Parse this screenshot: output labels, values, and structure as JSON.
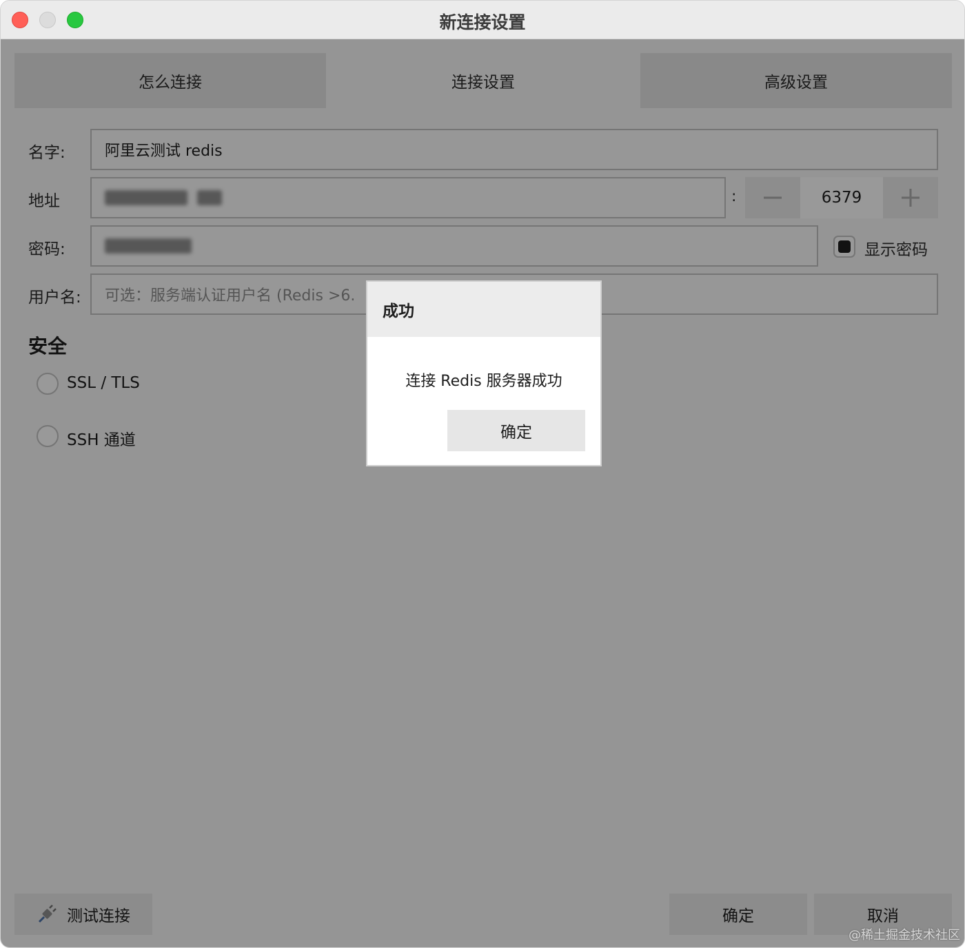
{
  "window": {
    "title": "新连接设置"
  },
  "tabs": [
    {
      "label": "怎么连接"
    },
    {
      "label": "连接设置"
    },
    {
      "label": "高级设置"
    }
  ],
  "form": {
    "name": {
      "label": "名字:",
      "value": "阿里云测试 redis"
    },
    "address": {
      "label": "地址",
      "value_hidden": true
    },
    "port": {
      "separator": ":",
      "value": "6379",
      "decrement_icon": "minus-icon",
      "increment_icon": "plus-icon"
    },
    "password": {
      "label": "密码:",
      "value_hidden": true
    },
    "show_password": {
      "label": "显示密码",
      "checked": true
    },
    "username": {
      "label": "用户名:",
      "placeholder": "可选：服务端认证用户名 (Redis >6."
    }
  },
  "security": {
    "title": "安全",
    "options": [
      {
        "label": "SSL / TLS",
        "selected": false
      },
      {
        "label": "SSH 通道",
        "selected": false
      }
    ]
  },
  "footer": {
    "test_label": "测试连接",
    "test_icon": "plug-icon",
    "ok_label": "确定",
    "cancel_label": "取消"
  },
  "dialog": {
    "title": "成功",
    "message": "连接 Redis 服务器成功",
    "ok_label": "确定"
  },
  "watermark": "@稀土掘金技术社区",
  "colors": {
    "close": "#ff5f57",
    "minimize": "#dcdcdc",
    "zoom": "#28c840"
  }
}
